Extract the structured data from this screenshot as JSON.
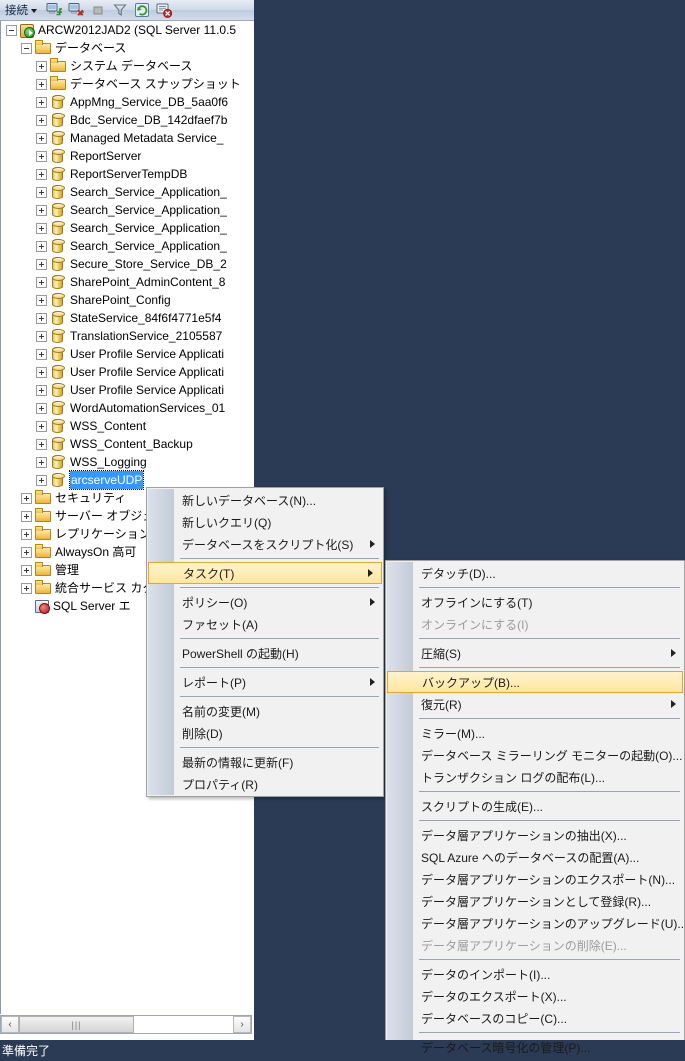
{
  "window": {
    "background_color": "#2b3a55",
    "status_text": "準備完了"
  },
  "toolbar": {
    "connect_label": "接続",
    "buttons": [
      {
        "name": "connect-object-explorer-icon",
        "title": "接続"
      },
      {
        "name": "disconnect-object-explorer-icon",
        "title": "切断"
      },
      {
        "name": "stop-icon",
        "title": "停止"
      },
      {
        "name": "filter-icon",
        "title": "フィルター"
      },
      {
        "name": "refresh-icon",
        "title": "最新の情報に更新"
      },
      {
        "name": "report-error-icon",
        "title": "レポート"
      }
    ]
  },
  "tree": {
    "root": {
      "label": "ARCW2012JAD2 (SQL Server 11.0.5",
      "icon": "server-icon",
      "expander": "minus"
    },
    "databases_node": {
      "label": "データベース",
      "icon": "folder-icon",
      "expander": "minus"
    },
    "databases": [
      {
        "label": "システム データベース",
        "icon": "folder-icon"
      },
      {
        "label": "データベース スナップショット",
        "icon": "folder-icon"
      },
      {
        "label": "AppMng_Service_DB_5aa0f6",
        "icon": "database-icon"
      },
      {
        "label": "Bdc_Service_DB_142dfaef7b",
        "icon": "database-icon"
      },
      {
        "label": "Managed Metadata Service_",
        "icon": "database-icon"
      },
      {
        "label": "ReportServer",
        "icon": "database-icon"
      },
      {
        "label": "ReportServerTempDB",
        "icon": "database-icon"
      },
      {
        "label": "Search_Service_Application_",
        "icon": "database-icon"
      },
      {
        "label": "Search_Service_Application_",
        "icon": "database-icon"
      },
      {
        "label": "Search_Service_Application_",
        "icon": "database-icon"
      },
      {
        "label": "Search_Service_Application_",
        "icon": "database-icon"
      },
      {
        "label": "Secure_Store_Service_DB_2",
        "icon": "database-icon"
      },
      {
        "label": "SharePoint_AdminContent_8",
        "icon": "database-icon"
      },
      {
        "label": "SharePoint_Config",
        "icon": "database-icon"
      },
      {
        "label": "StateService_84f6f4771e5f4",
        "icon": "database-icon"
      },
      {
        "label": "TranslationService_2105587",
        "icon": "database-icon"
      },
      {
        "label": "User Profile Service Applicati",
        "icon": "database-icon"
      },
      {
        "label": "User Profile Service Applicati",
        "icon": "database-icon"
      },
      {
        "label": "User Profile Service Applicati",
        "icon": "database-icon"
      },
      {
        "label": "WordAutomationServices_01",
        "icon": "database-icon"
      },
      {
        "label": "WSS_Content",
        "icon": "database-icon"
      },
      {
        "label": "WSS_Content_Backup",
        "icon": "database-icon"
      },
      {
        "label": "WSS_Logging",
        "icon": "database-icon"
      },
      {
        "label": "arcserveUDP",
        "icon": "database-icon",
        "selected": true
      }
    ],
    "server_nodes": [
      {
        "label": "セキュリティ",
        "icon": "folder-icon"
      },
      {
        "label": "サーバー オブジェ",
        "icon": "folder-icon"
      },
      {
        "label": "レプリケーション",
        "icon": "folder-icon"
      },
      {
        "label": "AlwaysOn 高可",
        "icon": "folder-icon"
      },
      {
        "label": "管理",
        "icon": "folder-icon"
      },
      {
        "label": "統合サービス カタ",
        "icon": "folder-icon"
      },
      {
        "label": "SQL Server エ",
        "icon": "agent-icon",
        "no_expander": true
      }
    ],
    "selection_color": "#3399ff"
  },
  "scrollbar": {
    "left_arrow": "‹",
    "right_arrow": "›",
    "thumb_grip": "|||"
  },
  "context_menu": {
    "items": [
      {
        "label": "新しいデータベース(N)...",
        "type": "item"
      },
      {
        "label": "新しいクエリ(Q)",
        "type": "item"
      },
      {
        "label": "データベースをスクリプト化(S)",
        "type": "item",
        "submenu": true
      },
      {
        "type": "separator"
      },
      {
        "label": "タスク(T)",
        "type": "item",
        "submenu": true,
        "highlighted": true
      },
      {
        "type": "separator"
      },
      {
        "label": "ポリシー(O)",
        "type": "item",
        "submenu": true
      },
      {
        "label": "ファセット(A)",
        "type": "item"
      },
      {
        "type": "separator"
      },
      {
        "label": "PowerShell の起動(H)",
        "type": "item"
      },
      {
        "type": "separator"
      },
      {
        "label": "レポート(P)",
        "type": "item",
        "submenu": true
      },
      {
        "type": "separator"
      },
      {
        "label": "名前の変更(M)",
        "type": "item"
      },
      {
        "label": "削除(D)",
        "type": "item"
      },
      {
        "type": "separator"
      },
      {
        "label": "最新の情報に更新(F)",
        "type": "item"
      },
      {
        "label": "プロパティ(R)",
        "type": "item"
      }
    ]
  },
  "tasks_submenu": {
    "items": [
      {
        "label": "デタッチ(D)...",
        "type": "item"
      },
      {
        "type": "separator"
      },
      {
        "label": "オフラインにする(T)",
        "type": "item"
      },
      {
        "label": "オンラインにする(I)",
        "type": "item",
        "disabled": true
      },
      {
        "type": "separator"
      },
      {
        "label": "圧縮(S)",
        "type": "item",
        "submenu": true
      },
      {
        "type": "separator"
      },
      {
        "label": "バックアップ(B)...",
        "type": "item",
        "highlighted": true
      },
      {
        "label": "復元(R)",
        "type": "item",
        "submenu": true
      },
      {
        "type": "separator"
      },
      {
        "label": "ミラー(M)...",
        "type": "item"
      },
      {
        "label": "データベース ミラーリング モニターの起動(O)...",
        "type": "item"
      },
      {
        "label": "トランザクション ログの配布(L)...",
        "type": "item"
      },
      {
        "type": "separator"
      },
      {
        "label": "スクリプトの生成(E)...",
        "type": "item"
      },
      {
        "type": "separator"
      },
      {
        "label": "データ層アプリケーションの抽出(X)...",
        "type": "item"
      },
      {
        "label": "SQL Azure へのデータベースの配置(A)...",
        "type": "item"
      },
      {
        "label": "データ層アプリケーションのエクスポート(N)...",
        "type": "item"
      },
      {
        "label": "データ層アプリケーションとして登録(R)...",
        "type": "item"
      },
      {
        "label": "データ層アプリケーションのアップグレード(U)...",
        "type": "item"
      },
      {
        "label": "データ層アプリケーションの削除(E)...",
        "type": "item",
        "disabled": true
      },
      {
        "type": "separator"
      },
      {
        "label": "データのインポート(I)...",
        "type": "item"
      },
      {
        "label": "データのエクスポート(X)...",
        "type": "item"
      },
      {
        "label": "データベースのコピー(C)...",
        "type": "item"
      },
      {
        "type": "separator"
      },
      {
        "label": "データベース暗号化の管理(P)...",
        "type": "item"
      }
    ]
  },
  "colors": {
    "highlight_fill_top": "#fff3cd",
    "highlight_fill_bottom": "#ffe6a0",
    "highlight_border": "#e3a72f",
    "menu_bg": "#f1f1f1",
    "gutter": "#c9d1de"
  }
}
